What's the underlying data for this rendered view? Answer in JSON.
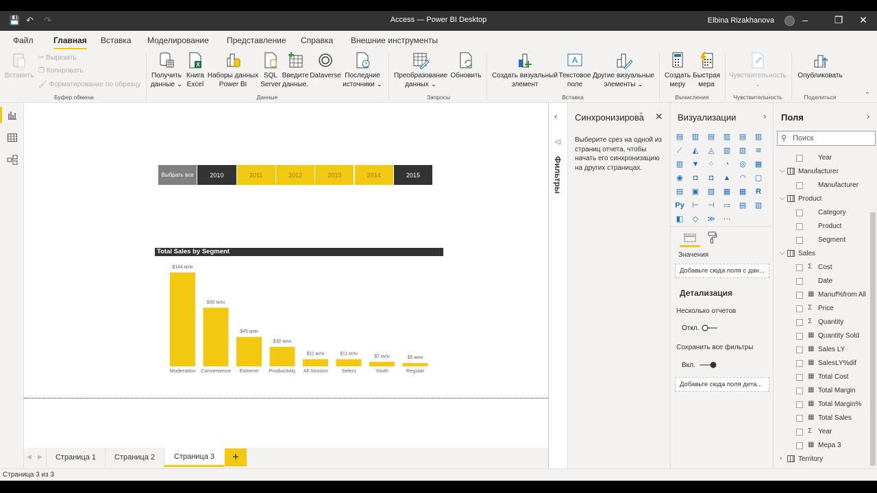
{
  "window": {
    "title": "Access — Power BI Desktop",
    "user": "Elbina Rizakhanova",
    "controls": [
      "minimize",
      "restore",
      "close"
    ]
  },
  "menu": {
    "tabs": [
      "Файл",
      "Главная",
      "Вставка",
      "Моделирование",
      "Представление",
      "Справка",
      "Внешние инструменты"
    ],
    "active": "Главная"
  },
  "ribbon": {
    "clipboard": {
      "paste": "Вставить",
      "cut": "Вырезать",
      "copy": "Копировать",
      "format_painter": "Форматирование по образцу",
      "group": "Буфер обмена"
    },
    "data": {
      "get_data": [
        "Получить",
        "данные ⌄"
      ],
      "excel": [
        "Книга",
        "Excel"
      ],
      "pbi_datasets": [
        "Наборы данных",
        "Power BI"
      ],
      "sql": [
        "SQL",
        "Server"
      ],
      "enter_data": [
        "Введите",
        "данные."
      ],
      "dataverse": [
        "Dataverse",
        ""
      ],
      "recent": [
        "Последние",
        "источники ⌄"
      ],
      "group": "Данные"
    },
    "queries": {
      "transform": [
        "Преобразование",
        "данных ⌄"
      ],
      "refresh": [
        "Обновить",
        ""
      ],
      "group": "Запросы"
    },
    "insert": {
      "new_visual": [
        "Создать визуальный",
        "элемент"
      ],
      "text_box": [
        "Текстовое",
        "поле"
      ],
      "more_visuals": [
        "Другие визуальные",
        "элементы ⌄"
      ],
      "group": "Вставка"
    },
    "calculations": {
      "new_measure": [
        "Создать",
        "меру"
      ],
      "quick_measure": [
        "Быстрая",
        "мера"
      ],
      "group": "Вычисления"
    },
    "sensitivity": {
      "label": [
        "Чувствительность",
        "⌄"
      ],
      "group": "Чувствительность"
    },
    "share": {
      "publish": [
        "Опубликовать",
        ""
      ],
      "group": "Поделиться"
    }
  },
  "slicer": {
    "items": [
      {
        "label": "Выбрать все",
        "state": "select-all"
      },
      {
        "label": "2010",
        "state": "unselected"
      },
      {
        "label": "2011",
        "state": "selected"
      },
      {
        "label": "2012",
        "state": "selected"
      },
      {
        "label": "2013",
        "state": "selected"
      },
      {
        "label": "2014",
        "state": "selected"
      },
      {
        "label": "2015",
        "state": "unselected"
      }
    ],
    "colors": {
      "selected": "#f2c811",
      "unselected": "#333333",
      "select_all": "#7f7f7f"
    }
  },
  "chart_data": {
    "type": "bar",
    "title": "Total Sales by Segment",
    "categories": [
      "Moderation",
      "Convenience",
      "Extreme",
      "Productivity",
      "All Season",
      "Select",
      "Youth",
      "Regular"
    ],
    "values": [
      144,
      90,
      45,
      30,
      11,
      11,
      7,
      5
    ],
    "data_labels": [
      "$144 млн",
      "$90 млн",
      "$45 млн",
      "$30 млн",
      "$11 млн",
      "$11 млн",
      "$7 млн",
      "$5 млн"
    ],
    "unit": "млн $",
    "xlabel": "",
    "ylabel": "",
    "ylim": [
      0,
      144
    ],
    "grid": false,
    "bar_color": "#f2c811"
  },
  "pages": {
    "tabs": [
      "Страница 1",
      "Страница 2",
      "Страница 3"
    ],
    "active": "Страница 3",
    "add": "+",
    "status": "Страница 3 из 3"
  },
  "filters_pane": {
    "label": "Фильтры"
  },
  "sync_pane": {
    "title": "Синхронизирова",
    "message": "Выберите срез на одной из страниц отчета, чтобы начать его синхронизацию на других страницах."
  },
  "viz_pane": {
    "title": "Визуализации",
    "values_label": "Значения",
    "values_drop": "Добавьте сюда поля с дан...",
    "drillthrough_title": "Детализация",
    "cross_report": "Несколько отчетов",
    "cross_report_state": "Откл.",
    "keep_filters": "Сохранить все фильтры",
    "keep_filters_state": "Вкл.",
    "drill_drop": "Добавьте сюда поля дета...",
    "icons": [
      "stacked-bar",
      "stacked-column",
      "clustered-bar",
      "clustered-column",
      "100-stacked-bar",
      "100-stacked-column",
      "line",
      "area",
      "stacked-area",
      "line-clustered-column",
      "line-stacked-column",
      "ribbon",
      "waterfall",
      "funnel",
      "scatter",
      "pie",
      "donut",
      "treemap",
      "map",
      "filled-map",
      "shape-map",
      "azure-map",
      "gauge",
      "card",
      "multi-row-card",
      "kpi",
      "slicer",
      "table",
      "matrix",
      "r-visual",
      "python-visual",
      "key-influencers",
      "decomposition-tree",
      "qa",
      "paginated-report",
      "smart-narrative",
      "power-apps",
      "power-automate",
      "power-automate-flow",
      "more"
    ],
    "accent": "#f2c811"
  },
  "fields_pane": {
    "title": "Поля",
    "search_placeholder": "Поиск",
    "rows": [
      {
        "kind": "field",
        "name": "Year",
        "type": ""
      },
      {
        "kind": "table",
        "name": "Manufacturer",
        "expanded": true
      },
      {
        "kind": "field",
        "name": "Manufacturer",
        "type": ""
      },
      {
        "kind": "table",
        "name": "Product",
        "expanded": true
      },
      {
        "kind": "field",
        "name": "Category",
        "type": ""
      },
      {
        "kind": "field",
        "name": "Product",
        "type": ""
      },
      {
        "kind": "field",
        "name": "Segment",
        "type": ""
      },
      {
        "kind": "table",
        "name": "Sales",
        "expanded": true
      },
      {
        "kind": "field",
        "name": "Cost",
        "type": "sum"
      },
      {
        "kind": "field",
        "name": "Date",
        "type": ""
      },
      {
        "kind": "field",
        "name": "Manuf%from All",
        "type": "measure"
      },
      {
        "kind": "field",
        "name": "Price",
        "type": "sum"
      },
      {
        "kind": "field",
        "name": "Quantity",
        "type": "sum"
      },
      {
        "kind": "field",
        "name": "Quantity Sold",
        "type": "measure"
      },
      {
        "kind": "field",
        "name": "Sales LY",
        "type": "measure"
      },
      {
        "kind": "field",
        "name": "SalesLY%dif",
        "type": "measure"
      },
      {
        "kind": "field",
        "name": "Total Cost",
        "type": "measure"
      },
      {
        "kind": "field",
        "name": "Total Margin",
        "type": "measure"
      },
      {
        "kind": "field",
        "name": "Total Margin%",
        "type": "measure"
      },
      {
        "kind": "field",
        "name": "Total Sales",
        "type": "measure"
      },
      {
        "kind": "field",
        "name": "Year",
        "type": "sum"
      },
      {
        "kind": "field",
        "name": "Мера 3",
        "type": "measure"
      },
      {
        "kind": "table",
        "name": "Territory",
        "expanded": false
      }
    ]
  }
}
